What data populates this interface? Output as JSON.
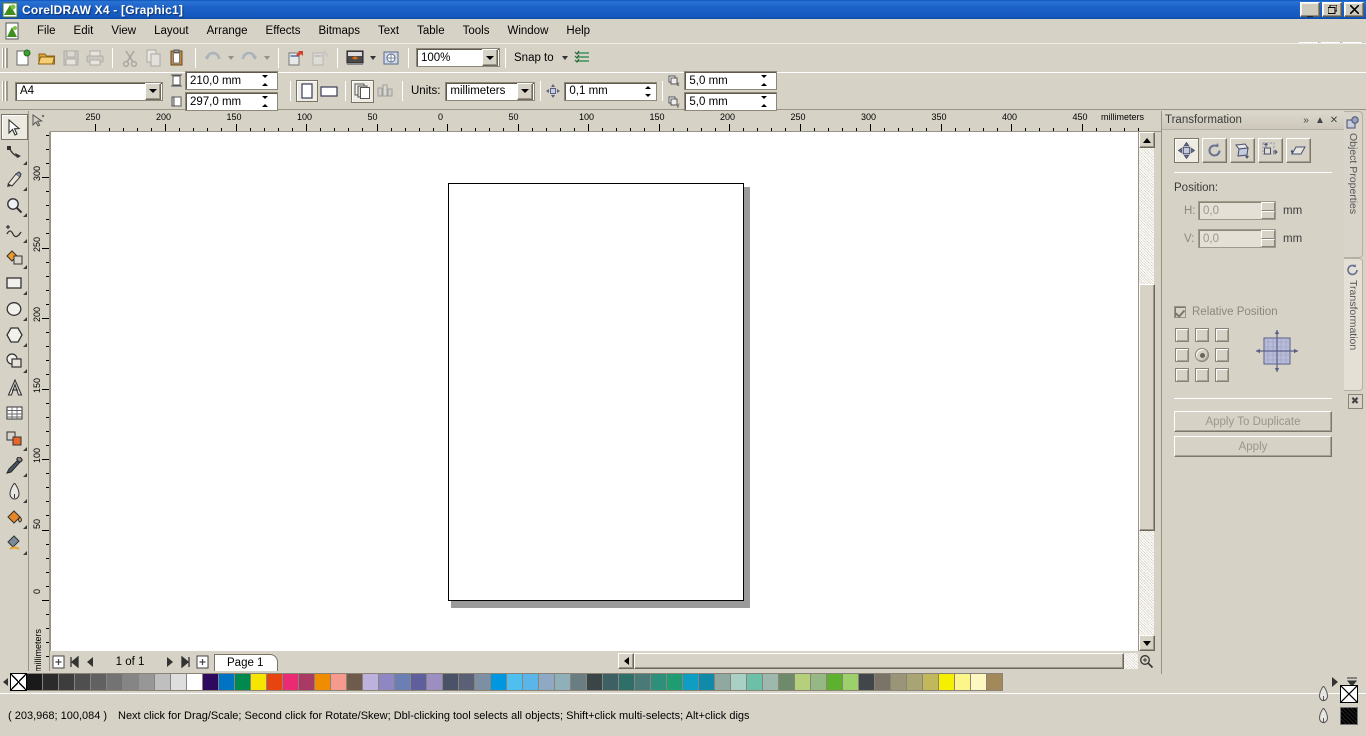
{
  "window": {
    "title": "CorelDRAW X4 - [Graphic1]",
    "minimize": "_",
    "restore": "❐",
    "close": "✕"
  },
  "menu": {
    "items": [
      {
        "label": "File",
        "accel": "F"
      },
      {
        "label": "Edit",
        "accel": "E"
      },
      {
        "label": "View",
        "accel": "V"
      },
      {
        "label": "Layout",
        "accel": "L"
      },
      {
        "label": "Arrange",
        "accel": "A"
      },
      {
        "label": "Effects",
        "accel": "c"
      },
      {
        "label": "Bitmaps",
        "accel": "B"
      },
      {
        "label": "Text",
        "accel": "T"
      },
      {
        "label": "Table",
        "accel": "a"
      },
      {
        "label": "Tools",
        "accel": "o"
      },
      {
        "label": "Window",
        "accel": "W"
      },
      {
        "label": "Help",
        "accel": "H"
      }
    ]
  },
  "toolbar": {
    "buttons": [
      {
        "name": "new-document-icon",
        "title": "New"
      },
      {
        "name": "open-document-icon",
        "title": "Open"
      },
      {
        "name": "save-document-icon",
        "title": "Save"
      },
      {
        "name": "print-icon",
        "title": "Print"
      },
      {
        "name": "cut-icon",
        "title": "Cut"
      },
      {
        "name": "copy-icon",
        "title": "Copy"
      },
      {
        "name": "paste-icon",
        "title": "Paste"
      },
      {
        "name": "undo-icon",
        "title": "Undo"
      },
      {
        "name": "redo-icon",
        "title": "Redo"
      },
      {
        "name": "import-icon",
        "title": "Import"
      },
      {
        "name": "export-icon",
        "title": "Export"
      },
      {
        "name": "application-launcher-icon",
        "title": "Application Launcher"
      },
      {
        "name": "corel-online-icon",
        "title": "Corel Online"
      }
    ],
    "zoom_level": "100%",
    "snap_to_label": "Snap to",
    "options_icon": "options-icon"
  },
  "property_bar": {
    "paper_type": "A4",
    "paper_width": "210,0 mm",
    "paper_height": "297,0 mm",
    "orientation_portrait": "portrait-icon",
    "orientation_landscape": "landscape-icon",
    "all_pages_icon": "all-pages-icon",
    "current_page_icon": "current-page-icon",
    "units_label": "Units:",
    "units_value": "millimeters",
    "nudge_value": "0,1 mm",
    "duplicate_x": "5,0 mm",
    "duplicate_y": "5,0 mm"
  },
  "toolbox": {
    "tools": [
      {
        "name": "pick-tool",
        "label": "Pick Tool",
        "selected": true,
        "flyout": false
      },
      {
        "name": "shape-tool",
        "label": "Shape Tool",
        "selected": false,
        "flyout": true
      },
      {
        "name": "crop-tool",
        "label": "Crop Tool",
        "selected": false,
        "flyout": true
      },
      {
        "name": "zoom-tool",
        "label": "Zoom Tool",
        "selected": false,
        "flyout": true
      },
      {
        "name": "freehand-tool",
        "label": "Freehand Tool",
        "selected": false,
        "flyout": true
      },
      {
        "name": "smart-fill-tool",
        "label": "Smart Fill Tool",
        "selected": false,
        "flyout": true
      },
      {
        "name": "rectangle-tool",
        "label": "Rectangle Tool",
        "selected": false,
        "flyout": true
      },
      {
        "name": "ellipse-tool",
        "label": "Ellipse Tool",
        "selected": false,
        "flyout": true
      },
      {
        "name": "polygon-tool",
        "label": "Polygon Tool",
        "selected": false,
        "flyout": true
      },
      {
        "name": "basic-shapes-tool",
        "label": "Basic Shapes Tool",
        "selected": false,
        "flyout": true
      },
      {
        "name": "text-tool",
        "label": "Text Tool",
        "selected": false,
        "flyout": false
      },
      {
        "name": "table-tool",
        "label": "Table Tool",
        "selected": false,
        "flyout": false
      },
      {
        "name": "blend-tool",
        "label": "Blend Tool",
        "selected": false,
        "flyout": true
      },
      {
        "name": "eyedropper-tool",
        "label": "Eyedropper Tool",
        "selected": false,
        "flyout": true
      },
      {
        "name": "outline-tool",
        "label": "Outline Tool",
        "selected": false,
        "flyout": true
      },
      {
        "name": "fill-tool",
        "label": "Fill Tool",
        "selected": false,
        "flyout": true
      },
      {
        "name": "interactive-fill-tool",
        "label": "Interactive Fill Tool",
        "selected": false,
        "flyout": true
      }
    ]
  },
  "rulers": {
    "unit_label": "millimeters",
    "horizontal_ticks": [
      "250",
      "200",
      "150",
      "100",
      "50",
      "0",
      "50",
      "100",
      "150",
      "200",
      "250",
      "300",
      "350",
      "400",
      "450"
    ],
    "vertical_ticks": [
      "300",
      "250",
      "200",
      "150",
      "100",
      "50",
      "0"
    ]
  },
  "page_nav": {
    "insert_before_icon": "insert-page-before-icon",
    "first_icon": "first-page-icon",
    "prev_icon": "previous-page-icon",
    "counter": "1 of 1",
    "next_icon": "next-page-icon",
    "last_icon": "last-page-icon",
    "insert_after_icon": "insert-page-after-icon",
    "tab_label": "Page 1"
  },
  "docker": {
    "title": "Transformation",
    "expand_icon": "»",
    "collapse_icon": "▲",
    "close_icon": "✕",
    "mode_buttons": [
      {
        "name": "position-mode-button",
        "label": "Position",
        "active": true
      },
      {
        "name": "rotate-mode-button",
        "label": "Rotate",
        "active": false
      },
      {
        "name": "scale-mirror-mode-button",
        "label": "Scale and Mirror",
        "active": false
      },
      {
        "name": "size-mode-button",
        "label": "Size",
        "active": false
      },
      {
        "name": "skew-mode-button",
        "label": "Skew",
        "active": false
      }
    ],
    "section_label": "Position:",
    "fields": [
      {
        "name": "position-h-field",
        "label": "H:",
        "value": "0,0",
        "unit": "mm"
      },
      {
        "name": "position-v-field",
        "label": "V:",
        "value": "0,0",
        "unit": "mm"
      }
    ],
    "relative_position_label": "Relative Position",
    "relative_position_checked": true,
    "apply_to_duplicate_label": "Apply To Duplicate",
    "apply_label": "Apply",
    "side_tabs": [
      {
        "name": "tab-object-properties",
        "label": "Object Properties",
        "icon": "object-properties-icon"
      },
      {
        "name": "tab-transformation",
        "label": "Transformation",
        "icon": "transformation-icon"
      }
    ],
    "side_close_icon": "✖"
  },
  "status_bar": {
    "coordinates": "( 203,968; 100,084 )",
    "hint": "Next click for Drag/Scale; Second click for Rotate/Skew; Dbl-clicking tool selects all objects; Shift+click multi-selects; Alt+click digs",
    "fill_swatch_color": "#000000",
    "outline_icon": "outline-pen-icon"
  },
  "palette": {
    "scroll_left_icon": "scroll-left-icon",
    "scroll_right_icon": "scroll-right-icon",
    "expand_icon": "expand-palette-icon",
    "no_color_label": "No Color",
    "colors": [
      "#1a1a1a",
      "#2b2b2b",
      "#3d3d3d",
      "#4f4f4f",
      "#616161",
      "#737373",
      "#858585",
      "#979797",
      "#bfbfbf",
      "#dedede",
      "#ffffff",
      "#2d0a5e",
      "#0073c4",
      "#00894f",
      "#f5e500",
      "#e8440f",
      "#ea2a72",
      "#a83a63",
      "#f08c00",
      "#f59a8c",
      "#6e5b4c",
      "#bdb2de",
      "#8f86c4",
      "#6b7fb5",
      "#5f5f9e",
      "#9a8fc0",
      "#4a5268",
      "#5a6075",
      "#7d8fa3",
      "#0096e0",
      "#4fbff0",
      "#5ab6e8",
      "#8fa8c4",
      "#8fb0b8",
      "#6a7d82",
      "#3a4548",
      "#3d6064",
      "#2e6f6a",
      "#4a7a78",
      "#2e8f7a",
      "#1f9c72",
      "#0e9ec4",
      "#1189a8",
      "#8fa8a0",
      "#a9d0c4",
      "#6cc0a8",
      "#9fb8ae",
      "#6f8a6a",
      "#b6cf7a",
      "#96b885",
      "#5db12f",
      "#9bd06a",
      "#40464a",
      "#7a7468",
      "#9a9478",
      "#a8a474",
      "#c0b85a",
      "#f7ef00",
      "#fbf58a",
      "#fdf7c0",
      "#a3895a"
    ]
  }
}
